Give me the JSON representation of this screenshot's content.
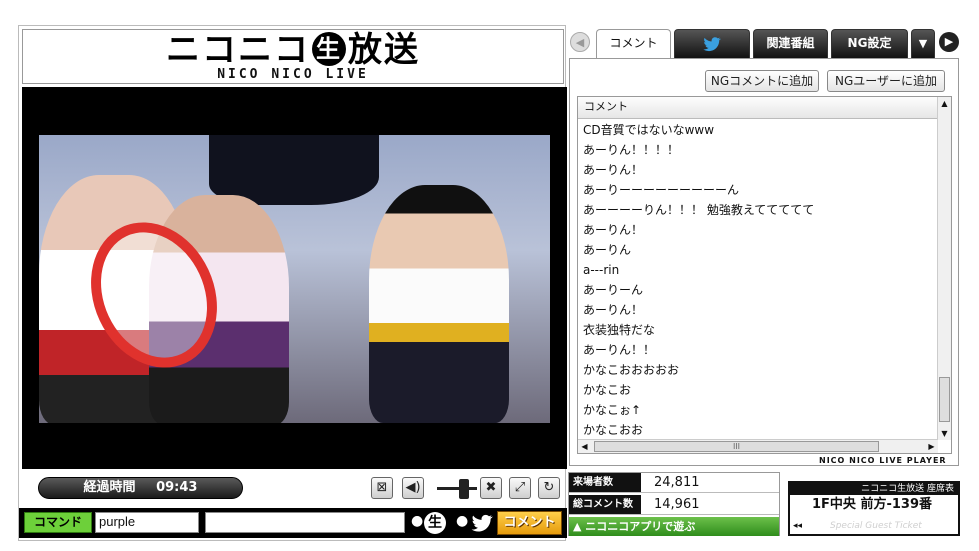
{
  "logo": {
    "text_before": "ニコニコ",
    "nama": "生",
    "text_after": "放送",
    "sub": "NICO NICO LIVE"
  },
  "controls": {
    "elapsed_label": "経過時間",
    "elapsed_time": "09:43"
  },
  "command_row": {
    "command_label": "コマンド",
    "command_value": "purple",
    "comment_value": "",
    "nama_radio": "●",
    "nama_label": "生",
    "twitter_radio": "●",
    "comment_button": "コメント"
  },
  "tabs": {
    "prev": "◀",
    "comment": "コメント",
    "related": "関連番組",
    "ng": "NG設定",
    "menu": "▼",
    "next": "▶"
  },
  "panel": {
    "ng_comment_button": "NGコメントに追加",
    "ng_user_button": "NGユーザーに追加",
    "list_header": "コメント",
    "comments": [
      "CD音質ではないなwww",
      "あーりん！！！！",
      "あーりん！",
      "あーりーーーーーーーーーん",
      "あーーーーりん！！！ 勉強教えててててて",
      "あーりん！",
      "あーりん",
      "a---rin",
      "あーりーん",
      "あーりん！",
      "衣装独特だな",
      "あーりん！！",
      "かなこおおおおお",
      "かなこお",
      "かなこぉ↑",
      "かなこおお"
    ],
    "hscroll_grip": "III",
    "brand": "NICO NICO LIVE PLAYER"
  },
  "stats": {
    "visitors_label": "来場者数",
    "visitors_value": "24,811",
    "comments_label": "総コメント数",
    "comments_value": "14,961",
    "app_link": "▲ ニコニコアプリで遊ぶ"
  },
  "ticket": {
    "header": "ニコニコ生放送 座席表",
    "seat": "1F中央 前方-139番",
    "footer": "Special Guest Ticket",
    "rewind": "◂◂"
  },
  "colors": {
    "command_green": "#6dd03a",
    "comment_orange": "#e59b0d",
    "app_green": "#2f8d1c"
  }
}
